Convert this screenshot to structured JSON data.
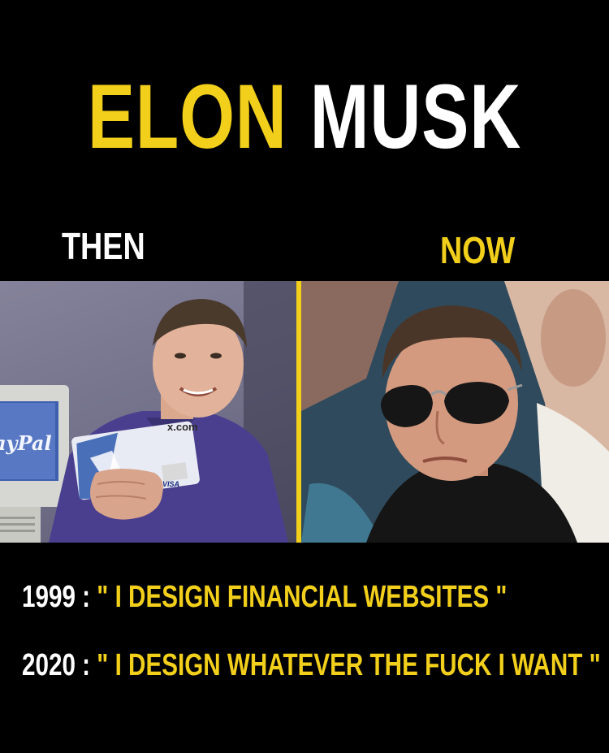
{
  "title": {
    "word1": "ELON",
    "word2": "MUSK"
  },
  "labels": {
    "then": "THEN",
    "now": "NOW"
  },
  "photo_left": {
    "card_brand": "x.com",
    "screen_text": "ayPal",
    "card_logo": "VISA"
  },
  "captions": [
    {
      "year": "1999 :",
      "quote": "\" I DESIGN FINANCIAL WEBSITES \""
    },
    {
      "year": "2020 :",
      "quote": "\" I DESIGN WHATEVER THE FUCK I WANT \""
    }
  ],
  "colors": {
    "accent": "#f2cf1a",
    "text": "#ffffff",
    "background": "#000000"
  }
}
